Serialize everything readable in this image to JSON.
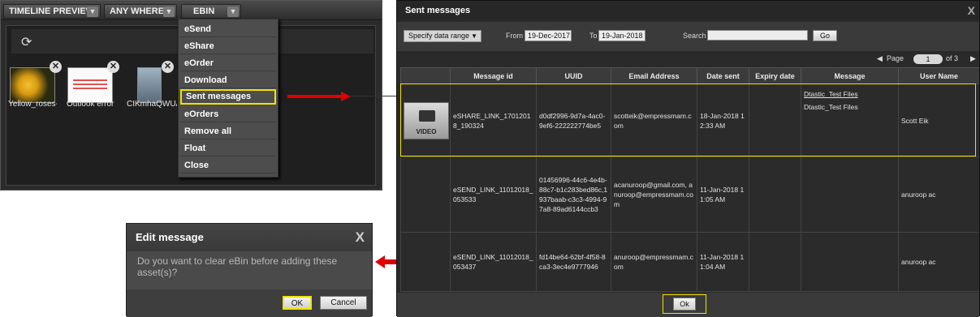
{
  "ebin": {
    "tabs": [
      {
        "label": "TIMELINE PREVIEW"
      },
      {
        "label": "ANY WHERE"
      },
      {
        "label": "EBIN"
      }
    ],
    "thumbnails": [
      {
        "label": "Yellow_roses-(",
        "icon": "image-thumbnail"
      },
      {
        "label": "Outlook error",
        "icon": "image-thumbnail"
      },
      {
        "label": "CIKmhaQWUA",
        "icon": "image-thumbnail"
      }
    ],
    "menu": [
      {
        "label": "eSend"
      },
      {
        "label": "eShare"
      },
      {
        "label": "eOrder"
      },
      {
        "label": "Download"
      },
      {
        "label": "Sent messages"
      },
      {
        "label": "eOrders"
      },
      {
        "label": "Remove all"
      },
      {
        "label": "Float"
      },
      {
        "label": "Close"
      }
    ]
  },
  "edit_dialog": {
    "title": "Edit message",
    "close_label": "X",
    "text": "Do you want to clear eBin before adding these asset(s)?",
    "ok_label": "OK",
    "cancel_label": "Cancel"
  },
  "sent_dialog": {
    "title": "Sent messages",
    "close_label": "X",
    "filter": {
      "range_select": "Specify data range",
      "from_label": "From",
      "from_value": "19-Dec-2017",
      "to_label": "To",
      "to_value": "19-Jan-2018",
      "search_label": "Search",
      "search_value": "",
      "go_label": "Go"
    },
    "pager": {
      "prev": "◀",
      "page_label": "Page",
      "page_value": "1",
      "of_label": "of 3",
      "next": "▶"
    },
    "columns": [
      "",
      "Message id",
      "UUID",
      "Email Address",
      "Date sent",
      "Expiry date",
      "Message",
      "User Name"
    ],
    "rows": [
      {
        "thumb_label": "VIDEO",
        "message_id": "eSHARE_LINK_17012018_190324",
        "uuid": "d0df2996-9d7a-4ac0-9ef6-222222774be5",
        "email": "scotteik@empressmam.com",
        "date_sent": "18-Jan-2018 12:33 AM",
        "expiry": "",
        "message_line1": "Dtastic_Test Files",
        "message_line2": "Dtastic_Test Files",
        "user": "Scott Eik"
      },
      {
        "thumb_label": "",
        "message_id": "eSEND_LINK_11012018_053533",
        "uuid": "01456996-44c6-4e4b-88c7-b1c283bed86c,1937baab-c3c3-4994-97a8-89ad6144ccb3",
        "email": "acanuroop@gmail.com, anuroop@empressmam.com",
        "date_sent": "11-Jan-2018 11:05 AM",
        "expiry": "",
        "message_line1": "",
        "message_line2": "",
        "user": "anuroop ac"
      },
      {
        "thumb_label": "",
        "message_id": "eSEND_LINK_11012018_053437",
        "uuid": "fd14be64-62bf-4f58-8ca3-3ec4e9777946",
        "email": "anuroop@empressmam.com",
        "date_sent": "11-Jan-2018 11:04 AM",
        "expiry": "",
        "message_line1": "",
        "message_line2": "",
        "user": "anuroop ac"
      }
    ],
    "ok_label": "Ok"
  },
  "colors": {
    "highlight": "#f2e200",
    "arrow": "#e00000",
    "panel": "#2b2b2b"
  }
}
